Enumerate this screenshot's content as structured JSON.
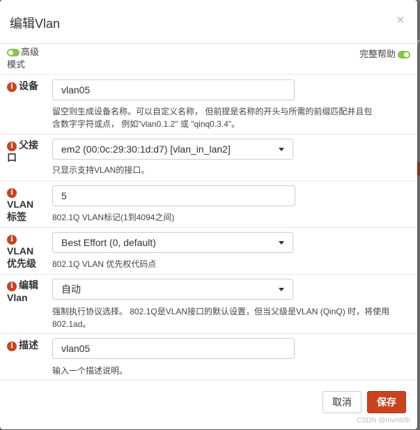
{
  "dialog": {
    "title": "编辑Vlan",
    "close": "×"
  },
  "toolbar": {
    "advanced_mode_line1": "高级",
    "advanced_mode_line2": "模式",
    "full_help": "完整帮助"
  },
  "fields": {
    "device": {
      "label": "设备",
      "value": "vlan05",
      "help_line1": "留空则生成设备名称。可以自定义名称， 但前提是名称的开头与所需的前缀匹配并且包",
      "help_line2": "含数字字符或点， 例如\"vlan0.1.2\" 或 \"qinq0.3.4\"。"
    },
    "parent": {
      "label_line1": "父接",
      "label_line2": "口",
      "value": "em2 (00:0c:29:30:1d:d7) [vlan_in_lan2]",
      "help": "只显示支持VLAN的接口。"
    },
    "vlan_tag": {
      "label_line1": "VLAN",
      "label_line2": "标签",
      "value": "5",
      "help": "802.1Q VLAN标记(1到4094之间)"
    },
    "vlan_priority": {
      "label_line1": "VLAN",
      "label_line2": "优先级",
      "value": "Best Effort (0, default)",
      "help": "802.1Q VLAN 优先权代码点"
    },
    "edit_vlan": {
      "label_line1": "编辑",
      "label_line2": "Vlan",
      "value": "自动",
      "help_line1": "强制执行协议选择。 802.1Q是VLAN接口的默认设置，但当父级是VLAN (QinQ) 时，将使用",
      "help_line2": "802.1ad。"
    },
    "description": {
      "label": "描述",
      "value": "vlan05",
      "help": "输入一个描述说明。"
    }
  },
  "footer": {
    "cancel_label": "取消",
    "save_label": "保存"
  },
  "watermark": "CSDN @mvmbfb",
  "colors": {
    "accent": "#c9431e",
    "toggle_on": "#8bc34a"
  },
  "icons": {
    "info": "info-icon",
    "close": "close-icon",
    "chevron": "chevron-down-icon"
  }
}
